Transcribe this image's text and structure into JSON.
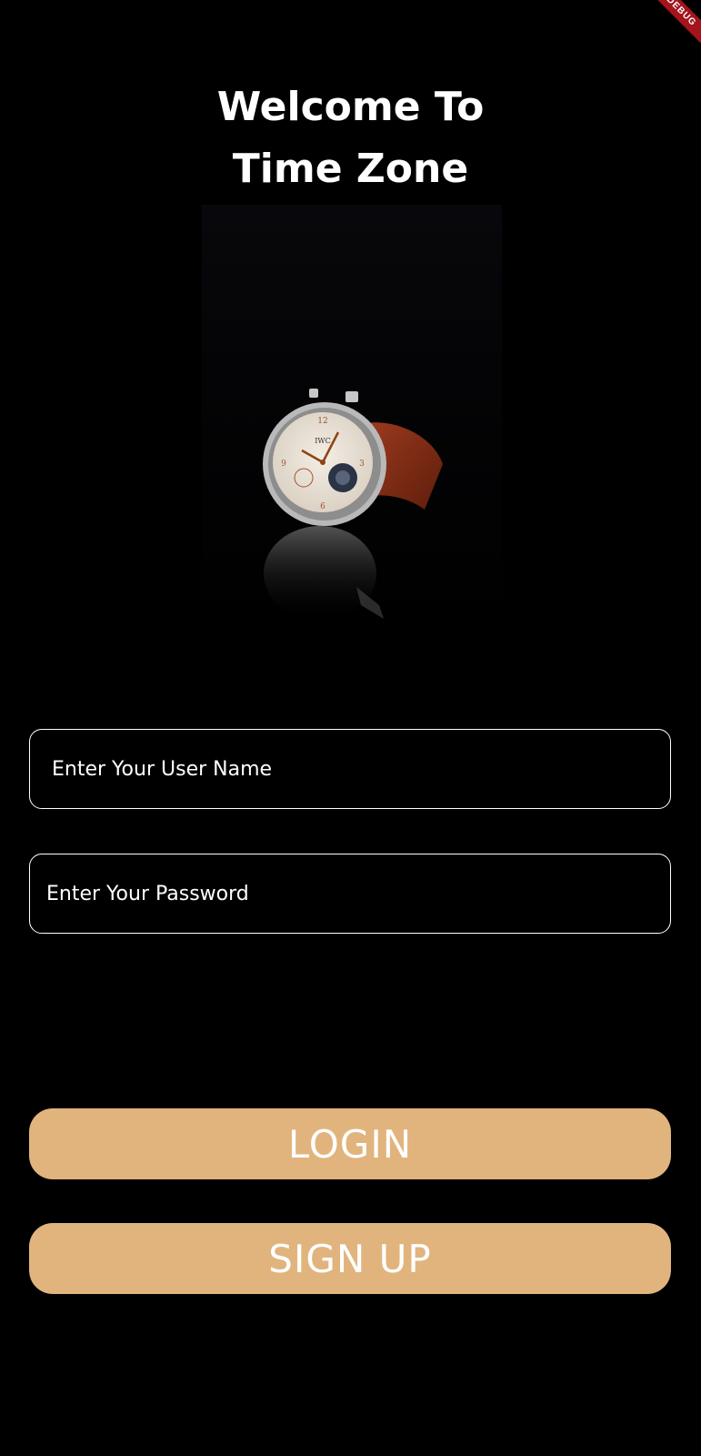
{
  "debug_banner": {
    "label": "DEBUG",
    "color": "#a3141c"
  },
  "header": {
    "title_line1": "Welcome To",
    "title_line2": "Time Zone"
  },
  "hero": {
    "image": "wristwatch-photo",
    "brand_mark": "IWC"
  },
  "form": {
    "username_placeholder": "Enter Your User Name",
    "password_placeholder": "Enter Your Password"
  },
  "actions": {
    "login_label": "LOGIN",
    "signup_label": "SIGN UP",
    "button_color": "#e1b47e"
  },
  "colors": {
    "background": "#000000",
    "text": "#ffffff",
    "field_border": "#ffffff"
  }
}
